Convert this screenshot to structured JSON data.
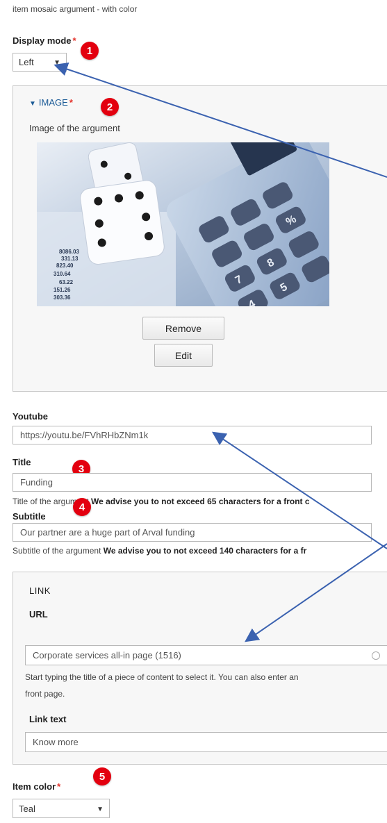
{
  "header": {
    "title": "item mosaic argument - with color"
  },
  "display_mode": {
    "label": "Display mode",
    "required": "*",
    "value": "Left"
  },
  "image_section": {
    "toggle_label": "IMAGE",
    "required": "*",
    "description": "Image of the argument",
    "remove_label": "Remove",
    "edit_label": "Edit",
    "ledger_numbers": [
      "8086.03",
      "331.13",
      "823.40",
      "310.64",
      "63.22",
      "151.26",
      "303.36"
    ]
  },
  "youtube": {
    "label": "Youtube",
    "value": "https://youtu.be/FVhRHbZNm1k"
  },
  "title_field": {
    "label": "Title",
    "value": "Funding",
    "description_plain": "Title of the argument",
    "description_bold": "We advise you to not exceed 65 characters for a front c"
  },
  "subtitle_field": {
    "label": "Subtitle",
    "value": "Our partner are a huge part of Arval funding",
    "description_plain": "Subtitle of the argument",
    "description_bold": "We advise you to not exceed 140 characters for a fr"
  },
  "link_section": {
    "legend": "LINK",
    "url_label": "URL",
    "url_value": "Corporate services all-in page  (1516)",
    "url_help_line1": "Start typing the title of a piece of content to select it. You can also enter an",
    "url_help_line2": "front page.",
    "link_text_label": "Link text",
    "link_text_value": "Know more"
  },
  "item_color": {
    "label": "Item color",
    "required": "*",
    "value": "Teal"
  },
  "badges": [
    "1",
    "2",
    "3",
    "4",
    "5"
  ],
  "colors": {
    "badge": "#e3000f",
    "arrow": "#3b62b0",
    "required": "#e4322b",
    "link_blue": "#1a5a96"
  },
  "icons": [
    "dropdown-caret-icon",
    "triangle-down-icon",
    "autocomplete-throbber-icon"
  ]
}
